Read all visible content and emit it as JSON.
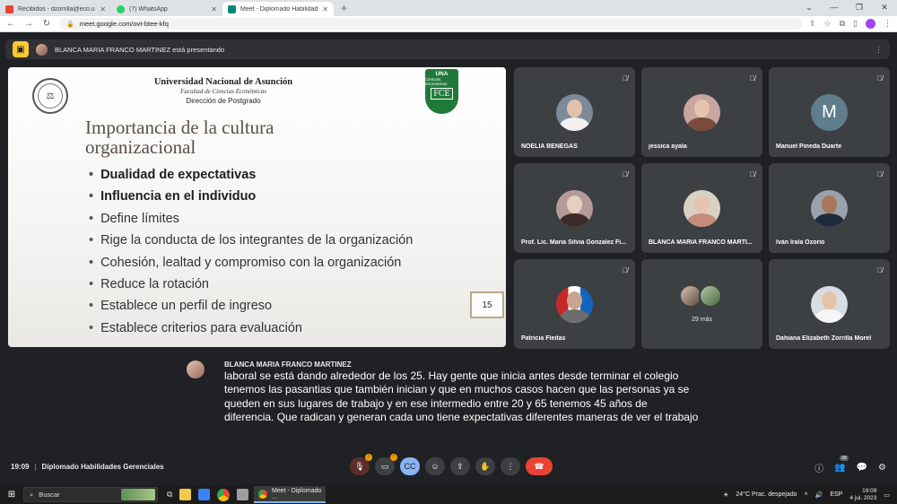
{
  "browser": {
    "tabs": [
      {
        "label": "Recibidos - dzorrilla@eco.una.py",
        "color": "#ea4335",
        "active": false
      },
      {
        "label": "(7) WhatsApp",
        "color": "#25d366",
        "active": false
      },
      {
        "label": "Meet - Diplomado Habilidades G",
        "color": "#00897b",
        "active": true
      }
    ],
    "new_tab": "+",
    "url": "meet.google.com/ovt-btee-kfq"
  },
  "banner": {
    "presenter_text": "BLANCA MARIA FRANCO MARTINEZ está presentando"
  },
  "slide": {
    "university": "Universidad Nacional de Asunción",
    "faculty": "Facultad de Ciencias Económicas",
    "department": "Dirección de Postgrado",
    "logo_top": "UNA",
    "logo_mid": "Ciencias Económicas",
    "logo_bottom": "FCE",
    "title": "Importancia de la cultura organizacional",
    "bullets": [
      "Dualidad de expectativas",
      "Influencia en el individuo",
      "Define límites",
      "Rige la conducta de los integrantes de la organización",
      "Cohesión, lealtad y compromiso con la organización",
      "Reduce la  rotación",
      "Establece un perfil de ingreso",
      "Establece criterios para evaluación"
    ],
    "page_number": "15"
  },
  "participants": [
    {
      "name": "NOELIA BENEGAS"
    },
    {
      "name": "jessica ayala"
    },
    {
      "name": "Manuel Pineda Duarte",
      "initial": "M"
    },
    {
      "name": "Prof. Lic. Maria Silvia Gonzalez Fi..."
    },
    {
      "name": "BLANCA MARIA FRANCO MARTI..."
    },
    {
      "name": "Iván Irala Ozorio"
    },
    {
      "name": "Patricia Fleitas"
    },
    {
      "more_label": "29 más"
    },
    {
      "name": "Dahiana Elizabeth Zorrilla Morel"
    }
  ],
  "caption": {
    "speaker": "BLANCA MARIA FRANCO MARTINEZ",
    "text": "laboral se está dando alrededor de los 25. Hay gente que inicia antes desde terminar el colegio tenemos las pasantias que también inician y que en muchos casos hacen que las personas ya se queden en sus lugares de trabajo y en ese intermedio entre 20 y 65 tenemos 45 años de diferencia. Que radican y generan cada uno tiene expectativas diferentes maneras de ver el trabajo"
  },
  "meeting": {
    "time": "19:09",
    "name": "Diplomado Habilidades Gerenciales",
    "participant_count": "39"
  },
  "taskbar": {
    "search_label": "Buscar",
    "active_app": "Meet - Diplomado ...",
    "weather": "24°C  Prac. despejado",
    "clock_time": "19:09",
    "clock_date": "4 jul. 2023"
  },
  "colors": {
    "background": "#202124",
    "tile": "#3c4043",
    "end_call": "#ea4335",
    "captions_active": "#8ab4f8"
  }
}
